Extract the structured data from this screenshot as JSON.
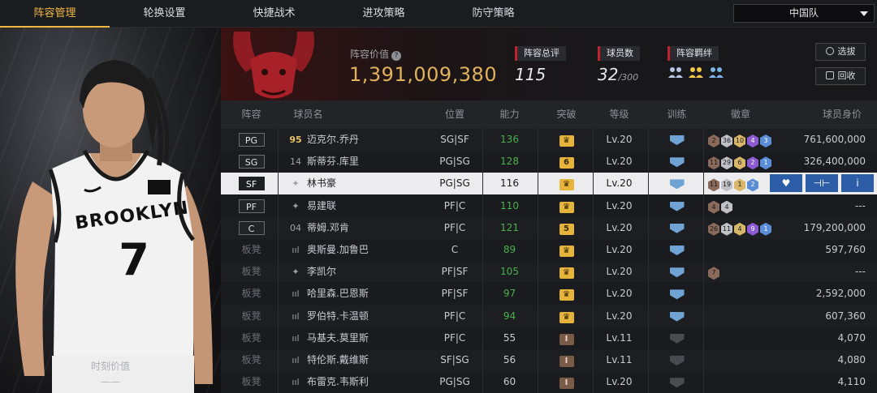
{
  "nav": {
    "tabs": [
      "阵容管理",
      "轮换设置",
      "快捷战术",
      "进攻策略",
      "防守策略"
    ],
    "active_tab": 0,
    "team_select": "中国队"
  },
  "hero": {
    "jersey_city": "BROOKLYN",
    "jersey_number": "7",
    "caption": "时刻价值",
    "caption_value": "——"
  },
  "summary": {
    "lineup_value_label": "阵容价值",
    "lineup_value": "1,391,009,380",
    "total_rating_label": "阵容总评",
    "total_rating": "115",
    "player_count_label": "球员数",
    "player_count": "32",
    "player_count_max": "/300",
    "bonds_label": "阵容羁绊",
    "btn_scout": "选拔",
    "btn_recycle": "回收"
  },
  "table": {
    "headers": [
      "阵容",
      "球员名",
      "位置",
      "能力",
      "突破",
      "等级",
      "训练",
      "徽章",
      "球员身价"
    ],
    "rows": [
      {
        "slot": "PG",
        "starter": true,
        "num": "95",
        "num_gold": true,
        "name": "迈克尔.乔丹",
        "pos": "SG|SF",
        "ability": "136",
        "ability_green": true,
        "breakthrough": "♛",
        "bt_brown": false,
        "level": "Lv.20",
        "train": "blue",
        "badges": [
          [
            "b-br",
            "2"
          ],
          [
            "b-si",
            "36"
          ],
          [
            "b-go",
            "10"
          ],
          [
            "b-pu",
            "4"
          ],
          [
            "b-bl",
            "3"
          ]
        ],
        "value": "761,600,000"
      },
      {
        "slot": "SG",
        "starter": true,
        "num": "14",
        "num_gold": false,
        "name": "斯蒂芬.库里",
        "pos": "PG|SG",
        "ability": "128",
        "ability_green": true,
        "breakthrough": "6",
        "bt_brown": false,
        "level": "Lv.20",
        "train": "blue",
        "badges": [
          [
            "b-br",
            "11"
          ],
          [
            "b-si",
            "29"
          ],
          [
            "b-go",
            "6"
          ],
          [
            "b-pu",
            "2"
          ],
          [
            "b-bl",
            "1"
          ]
        ],
        "value": "326,400,000"
      },
      {
        "slot": "SF",
        "starter": true,
        "num": "✦",
        "num_gold": false,
        "name": "林书豪",
        "pos": "PG|SG",
        "ability": "116",
        "ability_green": false,
        "breakthrough": "♛",
        "bt_brown": false,
        "level": "Lv.20",
        "train": "blue",
        "badges": [
          [
            "b-br",
            "11"
          ],
          [
            "b-si",
            "19"
          ],
          [
            "b-go",
            "1"
          ],
          [
            "b-bl",
            "2"
          ]
        ],
        "value": "",
        "selected": true
      },
      {
        "slot": "PF",
        "starter": true,
        "num": "✦",
        "num_gold": false,
        "name": "易建联",
        "pos": "PF|C",
        "ability": "110",
        "ability_green": true,
        "breakthrough": "♛",
        "bt_brown": false,
        "level": "Lv.20",
        "train": "blue",
        "badges": [
          [
            "b-br",
            "4"
          ],
          [
            "b-si",
            "4"
          ]
        ],
        "value": "---"
      },
      {
        "slot": "C",
        "starter": true,
        "num": "04",
        "num_gold": false,
        "name": "蒂姆.邓肯",
        "pos": "PF|C",
        "ability": "121",
        "ability_green": true,
        "breakthrough": "5",
        "bt_brown": false,
        "level": "Lv.20",
        "train": "blue",
        "badges": [
          [
            "b-br",
            "26"
          ],
          [
            "b-si",
            "11"
          ],
          [
            "b-go",
            "4"
          ],
          [
            "b-pu",
            "9"
          ],
          [
            "b-bl",
            "1"
          ]
        ],
        "value": "179,200,000"
      },
      {
        "slot": "板凳",
        "starter": false,
        "num": "ııl",
        "num_gold": false,
        "name": "奥斯曼.加鲁巴",
        "pos": "C",
        "ability": "89",
        "ability_green": true,
        "breakthrough": "♛",
        "bt_brown": false,
        "level": "Lv.20",
        "train": "blue",
        "badges": [],
        "value": "597,760"
      },
      {
        "slot": "板凳",
        "starter": false,
        "num": "✦",
        "num_gold": false,
        "name": "李凯尔",
        "pos": "PF|SF",
        "ability": "105",
        "ability_green": true,
        "breakthrough": "♛",
        "bt_brown": false,
        "level": "Lv.20",
        "train": "blue",
        "badges": [
          [
            "b-br",
            "7"
          ]
        ],
        "value": "---"
      },
      {
        "slot": "板凳",
        "starter": false,
        "num": "ııl",
        "num_gold": false,
        "name": "哈里森.巴恩斯",
        "pos": "PF|SF",
        "ability": "97",
        "ability_green": true,
        "breakthrough": "♛",
        "bt_brown": false,
        "level": "Lv.20",
        "train": "blue",
        "badges": [],
        "value": "2,592,000"
      },
      {
        "slot": "板凳",
        "starter": false,
        "num": "ııl",
        "num_gold": false,
        "name": "罗伯特.卡温顿",
        "pos": "PF|C",
        "ability": "94",
        "ability_green": true,
        "breakthrough": "♛",
        "bt_brown": false,
        "level": "Lv.20",
        "train": "blue",
        "badges": [],
        "value": "607,360"
      },
      {
        "slot": "板凳",
        "starter": false,
        "num": "ııl",
        "num_gold": false,
        "name": "马基夫.莫里斯",
        "pos": "PF|C",
        "ability": "55",
        "ability_green": false,
        "breakthrough": "I",
        "bt_brown": true,
        "level": "Lv.11",
        "train": "grey",
        "badges": [],
        "value": "4,070"
      },
      {
        "slot": "板凳",
        "starter": false,
        "num": "ııl",
        "num_gold": false,
        "name": "特伦斯.戴维斯",
        "pos": "SF|SG",
        "ability": "56",
        "ability_green": false,
        "breakthrough": "I",
        "bt_brown": true,
        "level": "Lv.11",
        "train": "grey",
        "badges": [],
        "value": "4,080"
      },
      {
        "slot": "板凳",
        "starter": false,
        "num": "ııl",
        "num_gold": false,
        "name": "布雷克.韦斯利",
        "pos": "PG|SG",
        "ability": "60",
        "ability_green": false,
        "breakthrough": "I",
        "bt_brown": true,
        "level": "Lv.20",
        "train": "grey",
        "badges": [],
        "value": "4,110"
      }
    ],
    "row_actions": [
      "♥",
      "⊣⊢",
      "i"
    ]
  }
}
